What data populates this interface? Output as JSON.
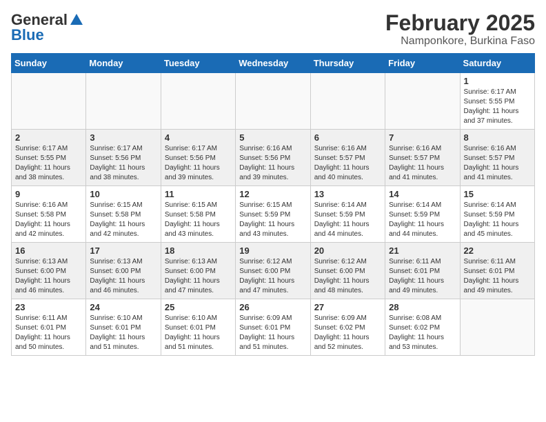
{
  "logo": {
    "general": "General",
    "blue": "Blue"
  },
  "title": {
    "month": "February 2025",
    "location": "Namponkore, Burkina Faso"
  },
  "weekdays": [
    "Sunday",
    "Monday",
    "Tuesday",
    "Wednesday",
    "Thursday",
    "Friday",
    "Saturday"
  ],
  "weeks": [
    [
      {
        "day": "",
        "detail": ""
      },
      {
        "day": "",
        "detail": ""
      },
      {
        "day": "",
        "detail": ""
      },
      {
        "day": "",
        "detail": ""
      },
      {
        "day": "",
        "detail": ""
      },
      {
        "day": "",
        "detail": ""
      },
      {
        "day": "1",
        "detail": "Sunrise: 6:17 AM\nSunset: 5:55 PM\nDaylight: 11 hours and 37 minutes."
      }
    ],
    [
      {
        "day": "2",
        "detail": "Sunrise: 6:17 AM\nSunset: 5:55 PM\nDaylight: 11 hours and 38 minutes."
      },
      {
        "day": "3",
        "detail": "Sunrise: 6:17 AM\nSunset: 5:56 PM\nDaylight: 11 hours and 38 minutes."
      },
      {
        "day": "4",
        "detail": "Sunrise: 6:17 AM\nSunset: 5:56 PM\nDaylight: 11 hours and 39 minutes."
      },
      {
        "day": "5",
        "detail": "Sunrise: 6:16 AM\nSunset: 5:56 PM\nDaylight: 11 hours and 39 minutes."
      },
      {
        "day": "6",
        "detail": "Sunrise: 6:16 AM\nSunset: 5:57 PM\nDaylight: 11 hours and 40 minutes."
      },
      {
        "day": "7",
        "detail": "Sunrise: 6:16 AM\nSunset: 5:57 PM\nDaylight: 11 hours and 41 minutes."
      },
      {
        "day": "8",
        "detail": "Sunrise: 6:16 AM\nSunset: 5:57 PM\nDaylight: 11 hours and 41 minutes."
      }
    ],
    [
      {
        "day": "9",
        "detail": "Sunrise: 6:16 AM\nSunset: 5:58 PM\nDaylight: 11 hours and 42 minutes."
      },
      {
        "day": "10",
        "detail": "Sunrise: 6:15 AM\nSunset: 5:58 PM\nDaylight: 11 hours and 42 minutes."
      },
      {
        "day": "11",
        "detail": "Sunrise: 6:15 AM\nSunset: 5:58 PM\nDaylight: 11 hours and 43 minutes."
      },
      {
        "day": "12",
        "detail": "Sunrise: 6:15 AM\nSunset: 5:59 PM\nDaylight: 11 hours and 43 minutes."
      },
      {
        "day": "13",
        "detail": "Sunrise: 6:14 AM\nSunset: 5:59 PM\nDaylight: 11 hours and 44 minutes."
      },
      {
        "day": "14",
        "detail": "Sunrise: 6:14 AM\nSunset: 5:59 PM\nDaylight: 11 hours and 44 minutes."
      },
      {
        "day": "15",
        "detail": "Sunrise: 6:14 AM\nSunset: 5:59 PM\nDaylight: 11 hours and 45 minutes."
      }
    ],
    [
      {
        "day": "16",
        "detail": "Sunrise: 6:13 AM\nSunset: 6:00 PM\nDaylight: 11 hours and 46 minutes."
      },
      {
        "day": "17",
        "detail": "Sunrise: 6:13 AM\nSunset: 6:00 PM\nDaylight: 11 hours and 46 minutes."
      },
      {
        "day": "18",
        "detail": "Sunrise: 6:13 AM\nSunset: 6:00 PM\nDaylight: 11 hours and 47 minutes."
      },
      {
        "day": "19",
        "detail": "Sunrise: 6:12 AM\nSunset: 6:00 PM\nDaylight: 11 hours and 47 minutes."
      },
      {
        "day": "20",
        "detail": "Sunrise: 6:12 AM\nSunset: 6:00 PM\nDaylight: 11 hours and 48 minutes."
      },
      {
        "day": "21",
        "detail": "Sunrise: 6:11 AM\nSunset: 6:01 PM\nDaylight: 11 hours and 49 minutes."
      },
      {
        "day": "22",
        "detail": "Sunrise: 6:11 AM\nSunset: 6:01 PM\nDaylight: 11 hours and 49 minutes."
      }
    ],
    [
      {
        "day": "23",
        "detail": "Sunrise: 6:11 AM\nSunset: 6:01 PM\nDaylight: 11 hours and 50 minutes."
      },
      {
        "day": "24",
        "detail": "Sunrise: 6:10 AM\nSunset: 6:01 PM\nDaylight: 11 hours and 51 minutes."
      },
      {
        "day": "25",
        "detail": "Sunrise: 6:10 AM\nSunset: 6:01 PM\nDaylight: 11 hours and 51 minutes."
      },
      {
        "day": "26",
        "detail": "Sunrise: 6:09 AM\nSunset: 6:01 PM\nDaylight: 11 hours and 51 minutes."
      },
      {
        "day": "27",
        "detail": "Sunrise: 6:09 AM\nSunset: 6:02 PM\nDaylight: 11 hours and 52 minutes."
      },
      {
        "day": "28",
        "detail": "Sunrise: 6:08 AM\nSunset: 6:02 PM\nDaylight: 11 hours and 53 minutes."
      },
      {
        "day": "",
        "detail": ""
      }
    ]
  ]
}
